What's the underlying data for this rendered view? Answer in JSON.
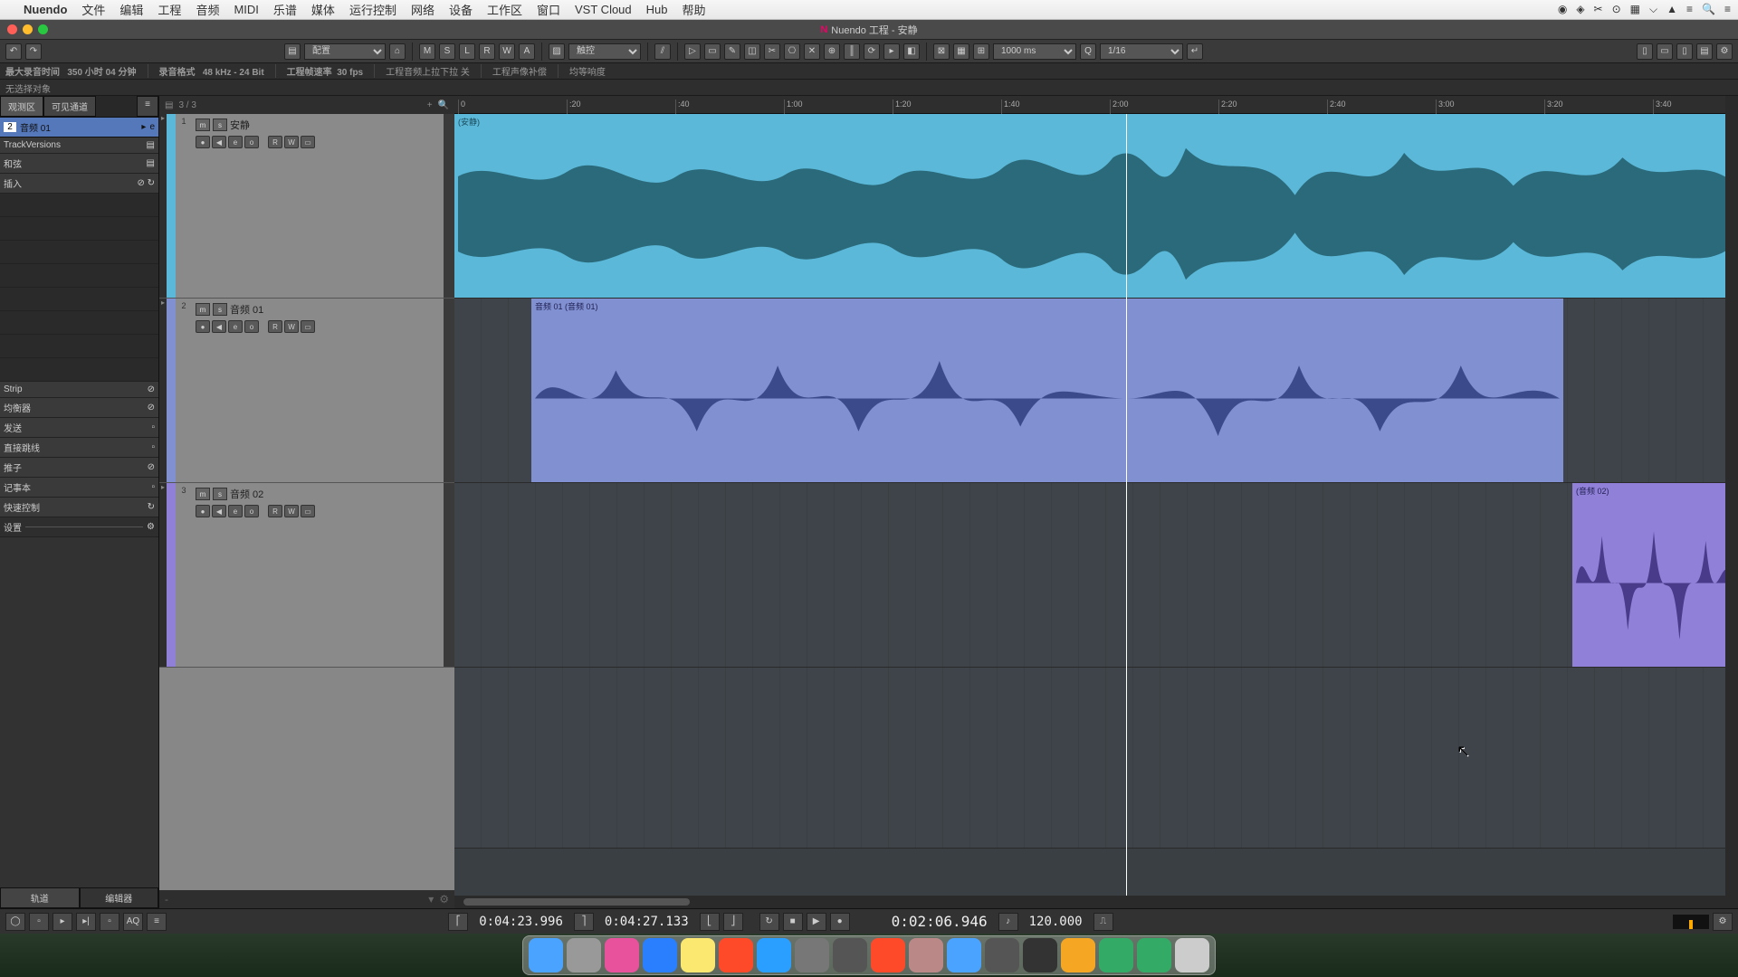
{
  "menubar": {
    "app": "Nuendo",
    "items": [
      "文件",
      "编辑",
      "工程",
      "音频",
      "MIDI",
      "乐谱",
      "媒体",
      "运行控制",
      "网络",
      "设备",
      "工作区",
      "窗口",
      "VST Cloud",
      "Hub",
      "帮助"
    ]
  },
  "window_title": "Nuendo 工程 - 安静",
  "toolbar": {
    "layout": "配置",
    "automation": [
      "M",
      "S",
      "L",
      "R",
      "W",
      "A"
    ],
    "snapmode": "触控",
    "grid_ms": "1000 ms",
    "quantize": "1/16"
  },
  "status": {
    "maxrec": "最大录音时间",
    "maxrec_val": "350 小时 04 分钟",
    "fmt_lbl": "录音格式",
    "fmt": "48 kHz - 24 Bit",
    "fps_lbl": "工程帧速率",
    "fps": "30 fps",
    "pullup": "工程音频上拉下拉  关",
    "comp": "工程声像补偿",
    "eqloud": "均等响度"
  },
  "selection_info": "无选择对象",
  "inspector": {
    "tab_observe": "观测区",
    "tab_visible": "可见通道",
    "track_num": "2",
    "track_name": "音频 01",
    "sections": {
      "trackversions": "TrackVersions",
      "chords": "和弦",
      "inserts": "插入",
      "strip": "Strip",
      "eq": "均衡器",
      "sends": "发送",
      "routing": "直接跳线",
      "fader": "推子",
      "notepad": "记事本",
      "quick": "快速控制",
      "settings": "设置"
    },
    "bottom_tabs": [
      "轨道",
      "编辑器"
    ]
  },
  "track_header_count": "3 / 3",
  "tracks": [
    {
      "n": "1",
      "name": "安静",
      "clip": "(安静)"
    },
    {
      "n": "2",
      "name": "音频 01",
      "clip": "音频 01 (音频 01)"
    },
    {
      "n": "3",
      "name": "音频 02",
      "clip": "(音频 02)"
    }
  ],
  "track_buttons": {
    "m": "m",
    "s": "s",
    "r": "R",
    "w": "W",
    "e": "e",
    "rec": "●",
    "mon": "◀",
    "o": "o",
    "lanes": "▭"
  },
  "ruler": [
    "0",
    ":20",
    ":40",
    "1:00",
    "1:20",
    "1:40",
    "2:00",
    "2:20",
    "2:40",
    "3:00",
    "3:20",
    "3:40"
  ],
  "transport": {
    "left": "0:04:23.996",
    "right": "0:04:27.133",
    "pri": "0:02:06.946",
    "tempo": "120.000",
    "aq": "AQ"
  },
  "dock_colors": [
    "#4aa3ff",
    "#999",
    "#e8519c",
    "#2a7fff",
    "#fbe870",
    "#ff4a2a",
    "#2a9fff",
    "#777",
    "#555",
    "#ff4a2a",
    "#b88",
    "#4aa3ff",
    "#555",
    "#333",
    "#f5a623",
    "#3a6",
    "#3a6",
    "#ccc"
  ]
}
